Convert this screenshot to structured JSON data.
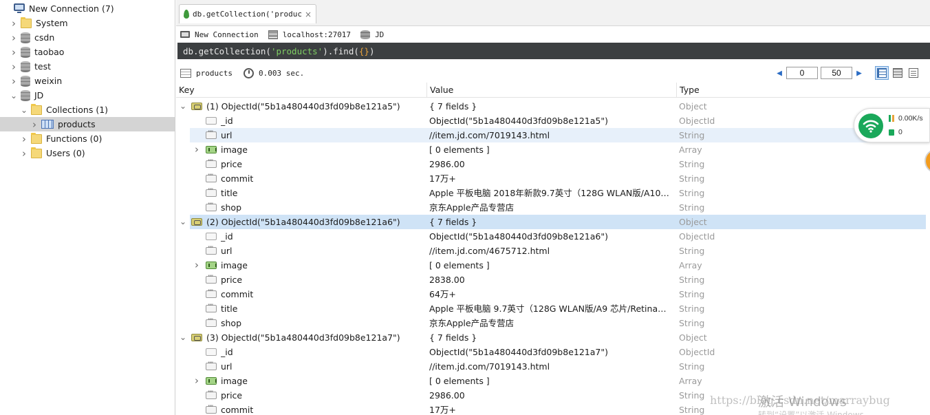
{
  "sidebar": {
    "connection": {
      "label": "New Connection (7)"
    },
    "items": [
      {
        "label": "System",
        "kind": "folder",
        "indent": 1,
        "expanded": false
      },
      {
        "label": "csdn",
        "kind": "db",
        "indent": 1,
        "expanded": false
      },
      {
        "label": "taobao",
        "kind": "db",
        "indent": 1,
        "expanded": false
      },
      {
        "label": "test",
        "kind": "db",
        "indent": 1,
        "expanded": false
      },
      {
        "label": "weixin",
        "kind": "db",
        "indent": 1,
        "expanded": false
      },
      {
        "label": "JD",
        "kind": "db",
        "indent": 1,
        "expanded": true
      },
      {
        "label": "Collections (1)",
        "kind": "folder",
        "indent": 2,
        "expanded": true
      },
      {
        "label": "products",
        "kind": "collection",
        "indent": 3,
        "expanded": false,
        "selected": true
      },
      {
        "label": "Functions (0)",
        "kind": "folder",
        "indent": 2,
        "expanded": false
      },
      {
        "label": "Users (0)",
        "kind": "folder",
        "indent": 2,
        "expanded": false
      }
    ]
  },
  "tab": {
    "title": "db.getCollection('product···",
    "close_glyph": "×"
  },
  "conninfo": {
    "connection": "New Connection",
    "server": "localhost:27017",
    "database": "JD"
  },
  "query": {
    "prefix": "db.getCollection(",
    "collection": "'products'",
    "mid": ").find(",
    "arg": "{}",
    "suffix": ")"
  },
  "resultbar": {
    "collection": "products",
    "time": "0.003 sec."
  },
  "pager": {
    "skip": "0",
    "limit": "50"
  },
  "columns": {
    "key": "Key",
    "value": "Value",
    "type": "Type"
  },
  "documents": [
    {
      "key": "(1) ObjectId(\"5b1a480440d3fd09b8e121a5\")",
      "value": "{ 7 fields }",
      "type": "Object",
      "fields": [
        {
          "key": "_id",
          "value": "ObjectId(\"5b1a480440d3fd09b8e121a5\")",
          "type": "ObjectId",
          "icon": "oid"
        },
        {
          "key": "url",
          "value": "//item.jd.com/7019143.html",
          "type": "String",
          "icon": "str",
          "highlight": true
        },
        {
          "key": "image",
          "value": "[ 0 elements ]",
          "type": "Array",
          "icon": "arr",
          "expandable": true
        },
        {
          "key": "price",
          "value": "2986.00",
          "type": "String",
          "icon": "str"
        },
        {
          "key": "commit",
          "value": "17万+",
          "type": "String",
          "icon": "str"
        },
        {
          "key": "title",
          "value": "Apple 平板电脑 2018年新款9.7英寸（128G WLAN版/A10 芯片...",
          "type": "String",
          "icon": "str"
        },
        {
          "key": "shop",
          "value": "京东Apple产品专营店",
          "type": "String",
          "icon": "str"
        }
      ]
    },
    {
      "key": "(2) ObjectId(\"5b1a480440d3fd09b8e121a6\")",
      "value": "{ 7 fields }",
      "type": "Object",
      "selected": true,
      "fields": [
        {
          "key": "_id",
          "value": "ObjectId(\"5b1a480440d3fd09b8e121a6\")",
          "type": "ObjectId",
          "icon": "oid"
        },
        {
          "key": "url",
          "value": "//item.jd.com/4675712.html",
          "type": "String",
          "icon": "str"
        },
        {
          "key": "image",
          "value": "[ 0 elements ]",
          "type": "Array",
          "icon": "arr",
          "expandable": true
        },
        {
          "key": "price",
          "value": "2838.00",
          "type": "String",
          "icon": "str"
        },
        {
          "key": "commit",
          "value": "64万+",
          "type": "String",
          "icon": "str"
        },
        {
          "key": "title",
          "value": "Apple 平板电脑 9.7英寸（128G WLAN版/A9 芯片/Retina显示...",
          "type": "String",
          "icon": "str"
        },
        {
          "key": "shop",
          "value": "京东Apple产品专营店",
          "type": "String",
          "icon": "str"
        }
      ]
    },
    {
      "key": "(3) ObjectId(\"5b1a480440d3fd09b8e121a7\")",
      "value": "{ 7 fields }",
      "type": "Object",
      "fields": [
        {
          "key": "_id",
          "value": "ObjectId(\"5b1a480440d3fd09b8e121a7\")",
          "type": "ObjectId",
          "icon": "oid"
        },
        {
          "key": "url",
          "value": "//item.jd.com/7019143.html",
          "type": "String",
          "icon": "str"
        },
        {
          "key": "image",
          "value": "[ 0 elements ]",
          "type": "Array",
          "icon": "arr",
          "expandable": true
        },
        {
          "key": "price",
          "value": "2986.00",
          "type": "String",
          "icon": "str"
        },
        {
          "key": "commit",
          "value": "17万+",
          "type": "String",
          "icon": "str"
        }
      ]
    }
  ],
  "network": {
    "speed": "0.00K/s",
    "count": "0"
  },
  "watermark": {
    "url": "https://blog.csdn.net/marraybug",
    "windows": "激活 Windows",
    "sub": "转到“设置”以激活 Windows。"
  },
  "colors": {
    "query_bg": "#3c3f41",
    "query_string": "#7fcf63",
    "query_brace": "#e9a23b",
    "selected_row": "#cfe3f6",
    "sidebar_selected": "#d4d4d4",
    "type_text": "#9a9a9a",
    "accent": "#2b6cc4"
  }
}
